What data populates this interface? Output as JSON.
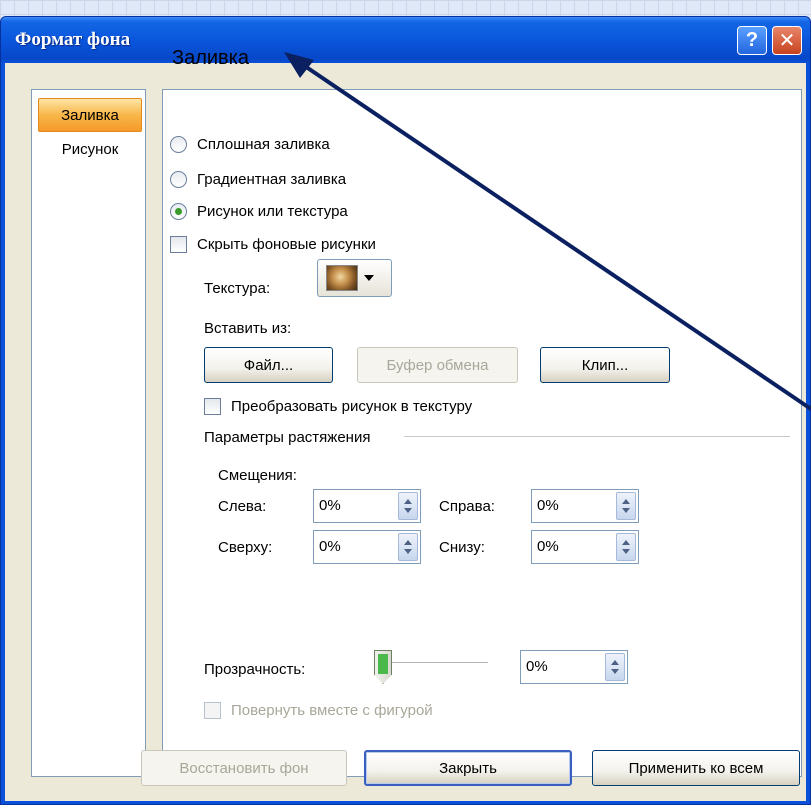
{
  "window": {
    "title": "Формат фона",
    "help_glyph": "?",
    "close_glyph": "✕"
  },
  "sidebar": {
    "items": [
      {
        "label": "Заливка",
        "selected": true
      },
      {
        "label": "Рисунок",
        "selected": false
      }
    ]
  },
  "panel": {
    "title": "Заливка",
    "fill_options": [
      {
        "label": "Сплошная заливка",
        "selected": false
      },
      {
        "label": "Градиентная заливка",
        "selected": false
      },
      {
        "label": "Рисунок или текстура",
        "selected": true
      }
    ],
    "hide_background_label": "Скрыть фоновые рисунки",
    "hide_background_checked": false,
    "texture_label": "Текстура:",
    "texture_icon": "texture-swatch",
    "insert_from_label": "Вставить из:",
    "file_button": "Файл...",
    "clipboard_button": "Буфер обмена",
    "clip_button": "Клип...",
    "tile_label": "Преобразовать рисунок в текстуру",
    "tile_checked": false,
    "stretch_section": "Параметры растяжения",
    "offsets_label": "Смещения:",
    "left_label": "Слева:",
    "left_value": "0%",
    "right_label": "Справа:",
    "right_value": "0%",
    "top_label": "Сверху:",
    "top_value": "0%",
    "bottom_label": "Снизу:",
    "bottom_value": "0%",
    "transparency_label": "Прозрачность:",
    "transparency_value": "0%",
    "transparency_fraction": 0,
    "rotate_label": "Повернуть вместе с фигурой",
    "rotate_checked": false
  },
  "footer": {
    "reset_button": "Восстановить фон",
    "close_button": "Закрыть",
    "apply_all_button": "Применить ко всем"
  },
  "colors": {
    "titlebar": "#0a50d8",
    "selected_item": "#f8b648",
    "annotation_arrow": "#0a2060"
  }
}
